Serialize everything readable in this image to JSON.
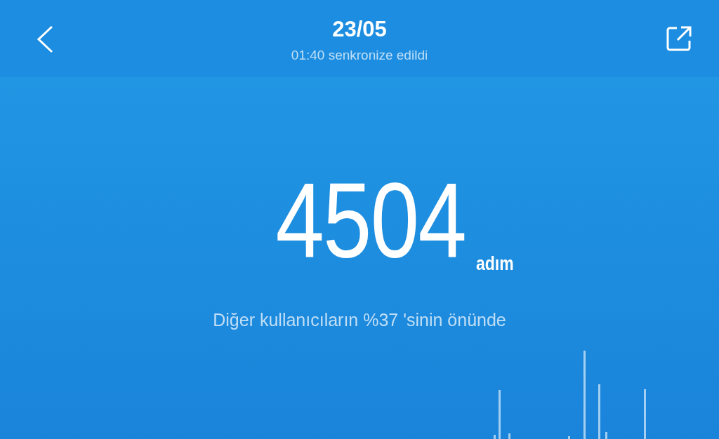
{
  "header": {
    "title": "23/05",
    "subtitle": "01:40 senkronize edildi"
  },
  "steps": {
    "value": "4504",
    "unit": "adım"
  },
  "ranking": "Diğer kullanıcıların %37 'sinin önünde"
}
